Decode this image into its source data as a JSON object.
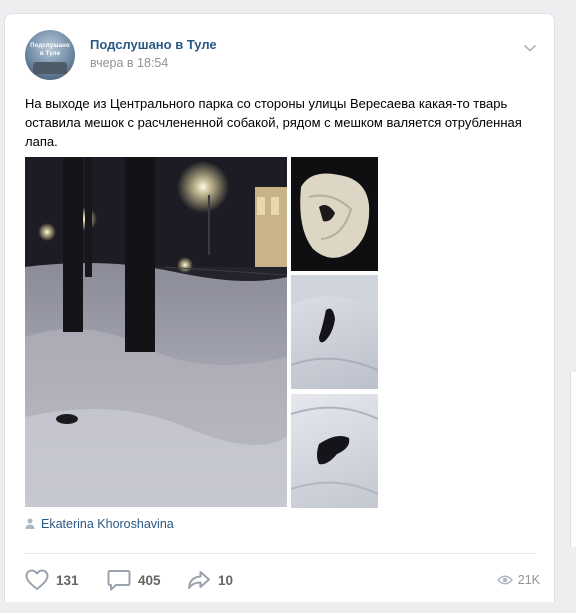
{
  "post": {
    "group_name": "Подслушано в Туле",
    "avatar_text_line1": "Подслушано",
    "avatar_text_line2": "в Туле",
    "time": "вчера в 18:54",
    "text": "На выходе из Центрального парка со стороны улицы Вересаева какая-то тварь оставила мешок с расчлененной собакой, рядом с мешком валяется отрубленная лапа.",
    "author": "Ekaterina Khoroshavina",
    "photos": [
      {
        "name": "night-park-photo"
      },
      {
        "name": "bag-photo"
      },
      {
        "name": "snow-photo-1"
      },
      {
        "name": "snow-photo-2"
      }
    ]
  },
  "actions": {
    "likes": "131",
    "comments": "405",
    "shares": "10",
    "views": "21K"
  },
  "icons": {
    "menu": "chevron-down-icon",
    "author": "person-icon",
    "like": "heart-icon",
    "comment": "comment-icon",
    "share": "share-arrow-icon",
    "views": "eye-icon"
  },
  "colors": {
    "link": "#2a5885",
    "muted": "#939393",
    "action_icon": "#99a2ad",
    "background": "#edeef0"
  }
}
